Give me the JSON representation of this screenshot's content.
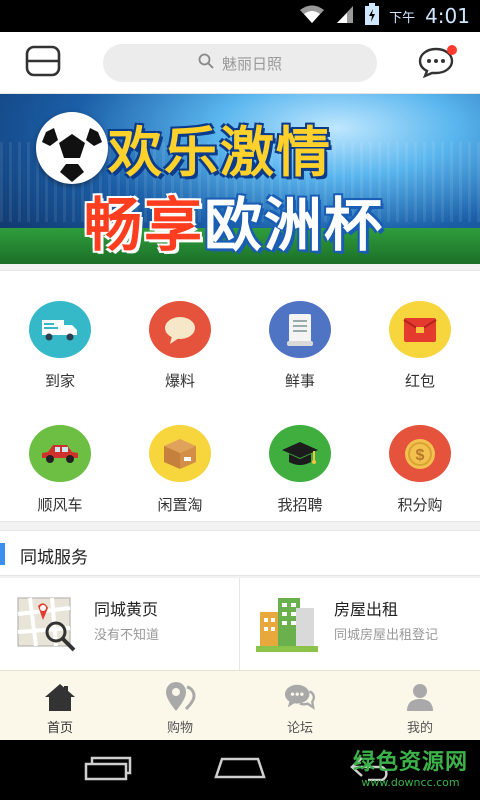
{
  "status_bar": {
    "ampm": "下午",
    "time": "4:01"
  },
  "header": {
    "search_placeholder": "魅丽日照"
  },
  "banner": {
    "line1": "欢乐激情",
    "line2a": "畅享",
    "line2b": "欧洲杯"
  },
  "quick_grid": [
    {
      "label": "到家",
      "icon": "delivery-truck-icon",
      "color": "#35b8c8"
    },
    {
      "label": "爆料",
      "icon": "speech-bubble-icon",
      "color": "#e6533c"
    },
    {
      "label": "鲜事",
      "icon": "scroll-icon",
      "color": "#4f74c4"
    },
    {
      "label": "红包",
      "icon": "red-envelope-icon",
      "color": "#f6d53d"
    },
    {
      "label": "顺风车",
      "icon": "car-icon",
      "color": "#6cbf43"
    },
    {
      "label": "闲置淘",
      "icon": "box-icon",
      "color": "#f6d53d"
    },
    {
      "label": "我招聘",
      "icon": "graduation-cap-icon",
      "color": "#3fae3f"
    },
    {
      "label": "积分购",
      "icon": "coin-icon",
      "color": "#e6533c"
    }
  ],
  "section": {
    "title": "同城服务"
  },
  "services": [
    {
      "name": "同城黄页",
      "desc": "没有不知道",
      "icon": "map-search-icon"
    },
    {
      "name": "房屋出租",
      "desc": "同城房屋出租登记",
      "icon": "buildings-icon"
    }
  ],
  "tabs": [
    {
      "label": "首页",
      "icon": "home-icon",
      "active": true
    },
    {
      "label": "购物",
      "icon": "location-pin-icon",
      "active": false
    },
    {
      "label": "论坛",
      "icon": "chat-bubbles-icon",
      "active": false
    },
    {
      "label": "我的",
      "icon": "person-icon",
      "active": false
    }
  ],
  "watermark": {
    "line1": "绿色资源网",
    "line2": "www.downcc.com"
  },
  "colors": {
    "accent_blue": "#3a8ef0",
    "tab_active": "#333333",
    "tab_inactive": "#a9a9a9",
    "notification": "#ff3b30"
  }
}
